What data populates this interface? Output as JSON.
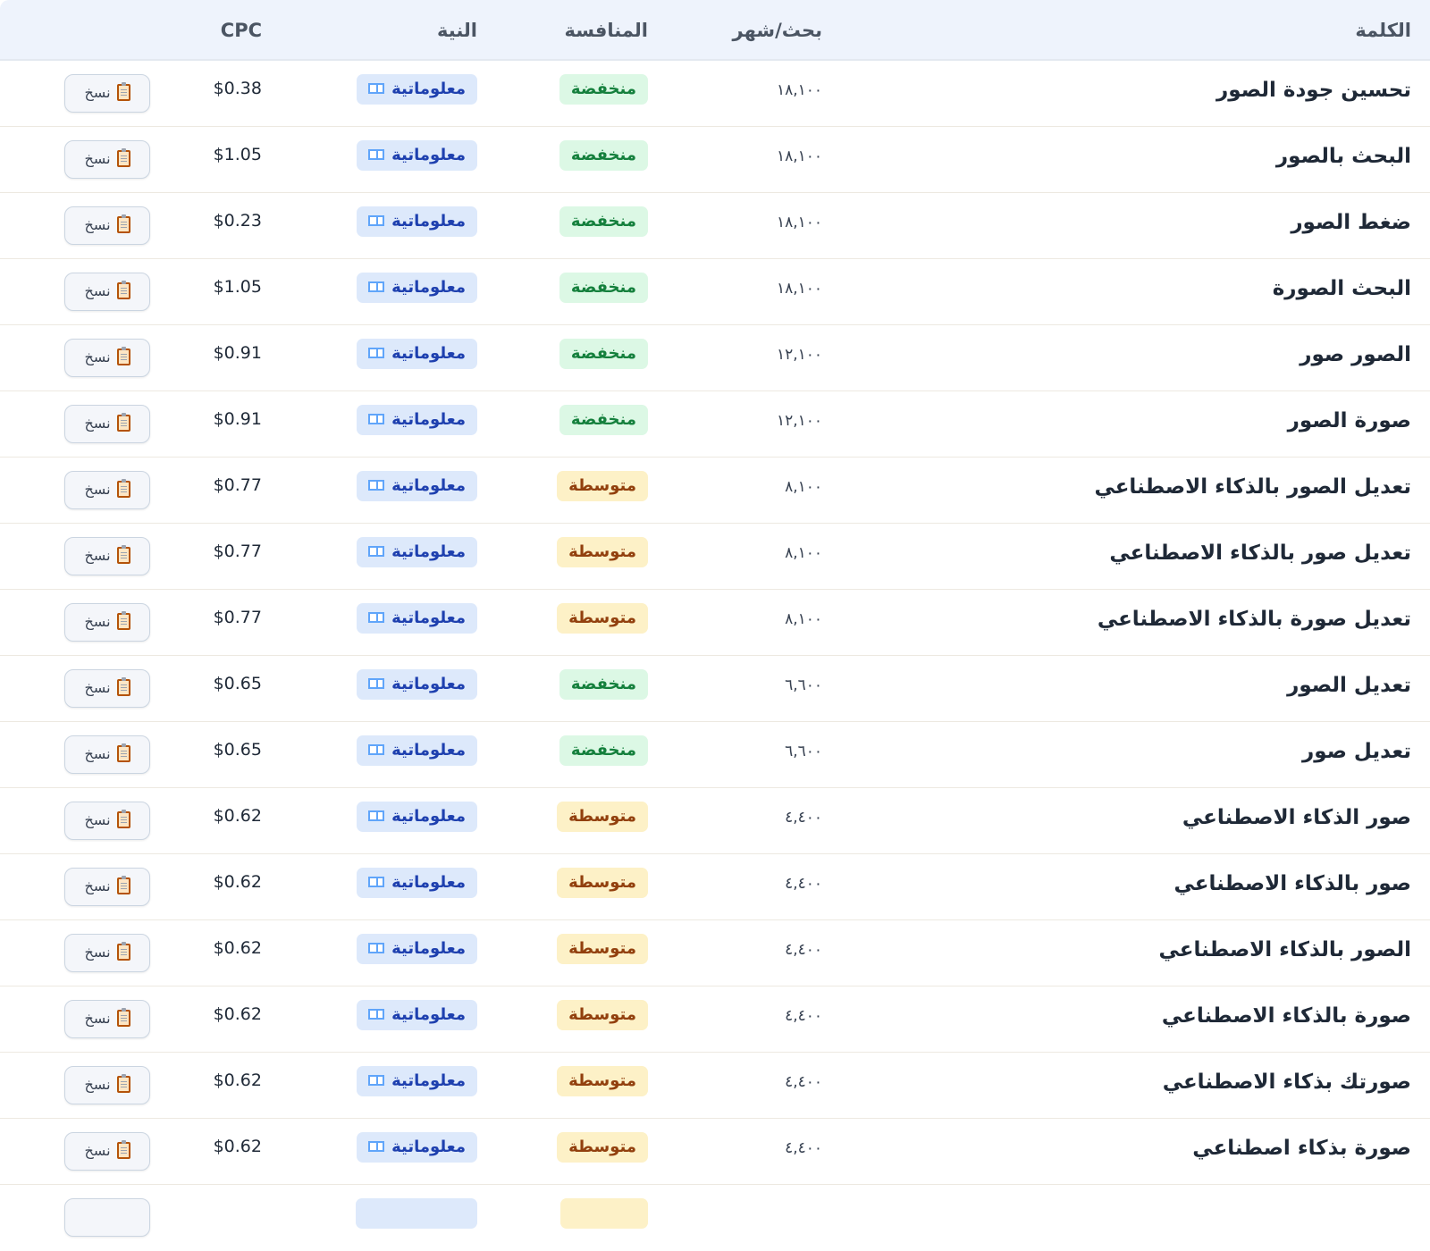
{
  "table": {
    "headers": {
      "keyword": "الكلمة",
      "volume": "بحث/شهر",
      "competition": "المنافسة",
      "intent": "النية",
      "cpc": "CPC"
    },
    "copy_label": "نسخ",
    "rows": [
      {
        "keyword": "تحسين جودة الصور",
        "volume": "١٨,١٠٠",
        "competition": "منخفضة",
        "level": "low",
        "intent": "معلوماتية",
        "cpc": "$0.38"
      },
      {
        "keyword": "البحث بالصور",
        "volume": "١٨,١٠٠",
        "competition": "منخفضة",
        "level": "low",
        "intent": "معلوماتية",
        "cpc": "$1.05"
      },
      {
        "keyword": "ضغط الصور",
        "volume": "١٨,١٠٠",
        "competition": "منخفضة",
        "level": "low",
        "intent": "معلوماتية",
        "cpc": "$0.23"
      },
      {
        "keyword": "البحث الصورة",
        "volume": "١٨,١٠٠",
        "competition": "منخفضة",
        "level": "low",
        "intent": "معلوماتية",
        "cpc": "$1.05"
      },
      {
        "keyword": "الصور صور",
        "volume": "١٢,١٠٠",
        "competition": "منخفضة",
        "level": "low",
        "intent": "معلوماتية",
        "cpc": "$0.91"
      },
      {
        "keyword": "صورة الصور",
        "volume": "١٢,١٠٠",
        "competition": "منخفضة",
        "level": "low",
        "intent": "معلوماتية",
        "cpc": "$0.91"
      },
      {
        "keyword": "تعديل الصور بالذكاء الاصطناعي",
        "volume": "٨,١٠٠",
        "competition": "متوسطة",
        "level": "mid",
        "intent": "معلوماتية",
        "cpc": "$0.77"
      },
      {
        "keyword": "تعديل صور بالذكاء الاصطناعي",
        "volume": "٨,١٠٠",
        "competition": "متوسطة",
        "level": "mid",
        "intent": "معلوماتية",
        "cpc": "$0.77"
      },
      {
        "keyword": "تعديل صورة بالذكاء الاصطناعي",
        "volume": "٨,١٠٠",
        "competition": "متوسطة",
        "level": "mid",
        "intent": "معلوماتية",
        "cpc": "$0.77"
      },
      {
        "keyword": "تعديل الصور",
        "volume": "٦,٦٠٠",
        "competition": "منخفضة",
        "level": "low",
        "intent": "معلوماتية",
        "cpc": "$0.65"
      },
      {
        "keyword": "تعديل صور",
        "volume": "٦,٦٠٠",
        "competition": "منخفضة",
        "level": "low",
        "intent": "معلوماتية",
        "cpc": "$0.65"
      },
      {
        "keyword": "صور الذكاء الاصطناعي",
        "volume": "٤,٤٠٠",
        "competition": "متوسطة",
        "level": "mid",
        "intent": "معلوماتية",
        "cpc": "$0.62"
      },
      {
        "keyword": "صور بالذكاء الاصطناعي",
        "volume": "٤,٤٠٠",
        "competition": "متوسطة",
        "level": "mid",
        "intent": "معلوماتية",
        "cpc": "$0.62"
      },
      {
        "keyword": "الصور بالذكاء الاصطناعي",
        "volume": "٤,٤٠٠",
        "competition": "متوسطة",
        "level": "mid",
        "intent": "معلوماتية",
        "cpc": "$0.62"
      },
      {
        "keyword": "صورة بالذكاء الاصطناعي",
        "volume": "٤,٤٠٠",
        "competition": "متوسطة",
        "level": "mid",
        "intent": "معلوماتية",
        "cpc": "$0.62"
      },
      {
        "keyword": "صورتك بذكاء الاصطناعي",
        "volume": "٤,٤٠٠",
        "competition": "متوسطة",
        "level": "mid",
        "intent": "معلوماتية",
        "cpc": "$0.62"
      },
      {
        "keyword": "صورة بذكاء اصطناعي",
        "volume": "٤,٤٠٠",
        "competition": "متوسطة",
        "level": "mid",
        "intent": "معلوماتية",
        "cpc": "$0.62"
      }
    ],
    "partial_row": {
      "competition_level": "mid"
    }
  },
  "colors": {
    "header_bg": "#eef3fc",
    "low_bg": "#dcf8e5",
    "low_text": "#15803d",
    "mid_bg": "#fdf1c7",
    "mid_text": "#92400e",
    "intent_bg": "#dde9fb",
    "intent_text": "#1e40af"
  },
  "icons": {
    "intent": "book-icon",
    "copy": "clipboard-icon"
  }
}
